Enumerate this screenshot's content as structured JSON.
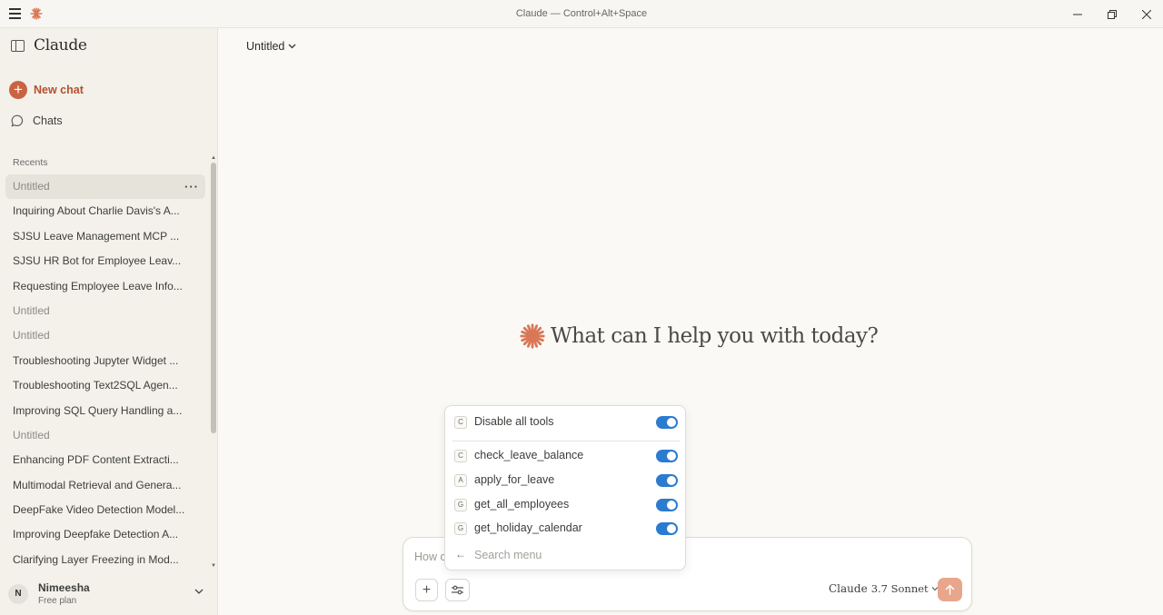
{
  "window": {
    "title": "Claude — Control+Alt+Space"
  },
  "sidebar": {
    "brand": "Claude",
    "new_chat_label": "New chat",
    "chats_label": "Chats",
    "recents_label": "Recents",
    "recents": [
      {
        "label": "Untitled",
        "muted": true,
        "active": true
      },
      {
        "label": "Inquiring About Charlie Davis's A...",
        "muted": false
      },
      {
        "label": "SJSU Leave Management MCP ...",
        "muted": false
      },
      {
        "label": "SJSU HR Bot for Employee Leav...",
        "muted": false
      },
      {
        "label": "Requesting Employee Leave Info...",
        "muted": false
      },
      {
        "label": "Untitled",
        "muted": true
      },
      {
        "label": "Untitled",
        "muted": true
      },
      {
        "label": "Troubleshooting Jupyter Widget ...",
        "muted": false
      },
      {
        "label": "Troubleshooting Text2SQL Agen...",
        "muted": false
      },
      {
        "label": "Improving SQL Query Handling a...",
        "muted": false
      },
      {
        "label": "Untitled",
        "muted": true
      },
      {
        "label": "Enhancing PDF Content Extracti...",
        "muted": false
      },
      {
        "label": "Multimodal Retrieval and Genera...",
        "muted": false
      },
      {
        "label": "DeepFake Video Detection Model...",
        "muted": false
      },
      {
        "label": "Improving Deepfake Detection A...",
        "muted": false
      },
      {
        "label": "Clarifying Layer Freezing in Mod...",
        "muted": false
      }
    ],
    "user": {
      "initial": "N",
      "name": "Nimeesha",
      "plan": "Free plan"
    }
  },
  "main": {
    "conversation_title": "Untitled",
    "greeting": "What can I help you with today?"
  },
  "composer": {
    "placeholder_visible": "How c",
    "model_name": "Claude",
    "model_version": "3.7 Sonnet"
  },
  "tools_menu": {
    "items": [
      {
        "badge": "C",
        "label": "Disable all tools",
        "enabled": true
      },
      {
        "badge": "C",
        "label": "check_leave_balance",
        "enabled": true
      },
      {
        "badge": "A",
        "label": "apply_for_leave",
        "enabled": true
      },
      {
        "badge": "G",
        "label": "get_all_employees",
        "enabled": true
      },
      {
        "badge": "G",
        "label": "get_holiday_calendar",
        "enabled": true
      }
    ],
    "search_placeholder": "Search menu"
  },
  "colors": {
    "accent": "#c96442",
    "toggle_on": "#2b7bd0",
    "send_button": "#e8a68c"
  }
}
